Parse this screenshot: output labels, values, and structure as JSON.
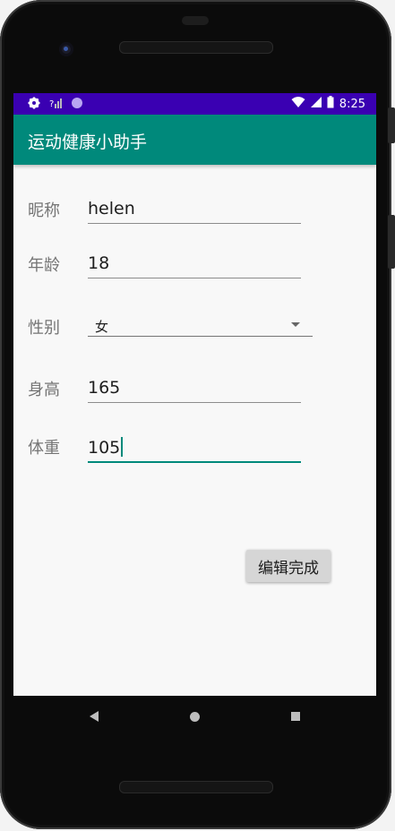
{
  "statusbar": {
    "icons": [
      "gear-icon",
      "signal-off-icon",
      "circle-icon"
    ],
    "right_icons": [
      "wifi-icon",
      "cell-signal-icon",
      "battery-icon"
    ],
    "time": "8:25"
  },
  "appbar": {
    "title": "运动健康小助手"
  },
  "form": {
    "nickname_label": "昵称",
    "nickname_value": "helen",
    "age_label": "年龄",
    "age_value": "18",
    "gender_label": "性别",
    "gender_value": "女",
    "height_label": "身高",
    "height_value": "165",
    "weight_label": "体重",
    "weight_value": "105"
  },
  "button": {
    "edit_done_label": "编辑完成"
  },
  "navbar": {
    "icons": [
      "back-icon",
      "home-icon",
      "recents-icon"
    ]
  },
  "colors": {
    "statusbar": "#3a00b2",
    "appbar": "#00897b",
    "accent": "#00897b"
  }
}
